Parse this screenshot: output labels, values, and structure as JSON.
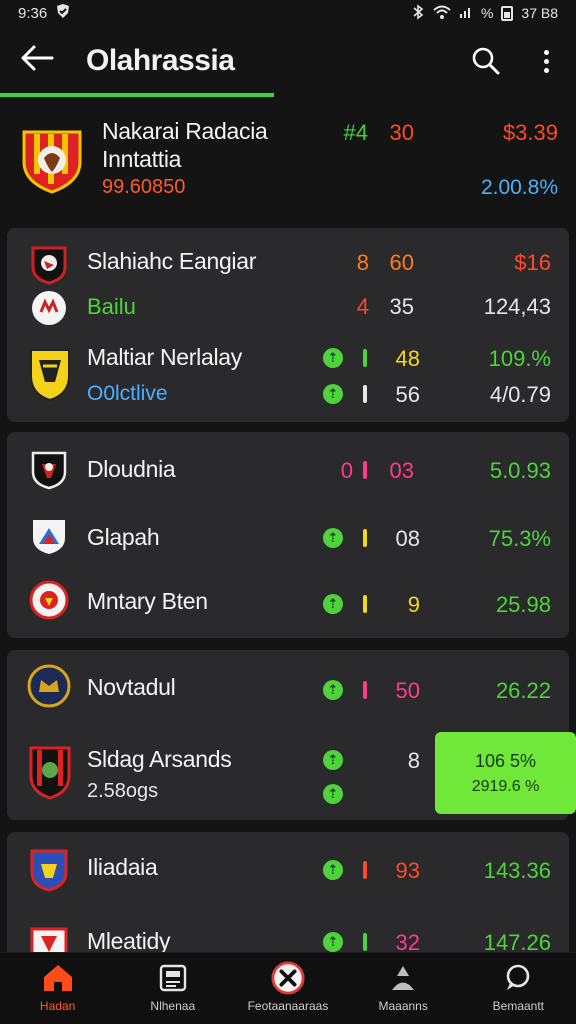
{
  "status_bar": {
    "time": "9:36",
    "right_text": "%",
    "right_time": "37 B8"
  },
  "app_bar": {
    "title": "Olahrassia"
  },
  "featured": {
    "name_line1": "Nakarai Radacia",
    "name_line2": "Inntattia",
    "sub": "99.60850",
    "num1": "#4",
    "num2": "30",
    "value": "$3.39",
    "value2": "2.00.8%"
  },
  "groups": [
    {
      "rows": [
        {
          "name": "Slahiahc Eangiar",
          "num1": "8",
          "num2": "60",
          "value": "$16"
        },
        {
          "name": "Bailu",
          "num1": "4",
          "num2": "35",
          "value": "124,43"
        },
        {
          "name": "Maltiar Nerlalay",
          "num1": "",
          "num2": "48",
          "value": "109.%"
        },
        {
          "name": "O0lctlive",
          "num1": "",
          "num2": "56",
          "value": "4/0.79"
        }
      ]
    },
    {
      "rows": [
        {
          "name": "Dloudnia",
          "num1": "0",
          "num2": "03",
          "value": "5.0.93"
        },
        {
          "name": "Glapah",
          "num1": "",
          "num2": "08",
          "value": "75.3%"
        },
        {
          "name": "Mntary Bten",
          "num1": "",
          "num2": "9",
          "value": "25.98"
        }
      ]
    },
    {
      "rows": [
        {
          "name": "Novtadul",
          "num1": "",
          "num2": "50",
          "value": "26.22"
        },
        {
          "name": "Sldag Arsands",
          "sub": "2.58ogs",
          "num2": "8",
          "highlight_a": "106 5%",
          "highlight_b": "2919.6 %"
        }
      ]
    },
    {
      "rows": [
        {
          "name": "Iliadaia",
          "num1": "",
          "num2": "93",
          "value": "143.36"
        },
        {
          "name": "Mleatidy",
          "num1": "",
          "num2": "32",
          "value": "147.26"
        }
      ]
    }
  ],
  "bottom_nav": [
    {
      "label": "Hadan"
    },
    {
      "label": "Nlhenaa"
    },
    {
      "label": "Feotaanaaraas"
    },
    {
      "label": "Maaanns"
    },
    {
      "label": "Bemaantt"
    }
  ],
  "colors": {
    "accent_green": "#3bd33b",
    "red": "#ff4a2a",
    "orange": "#ff7a1a",
    "yellow": "#f4d81e",
    "pink": "#ff3b8a",
    "blue": "#4ab0ff",
    "card_bg": "#2a2a2c"
  }
}
